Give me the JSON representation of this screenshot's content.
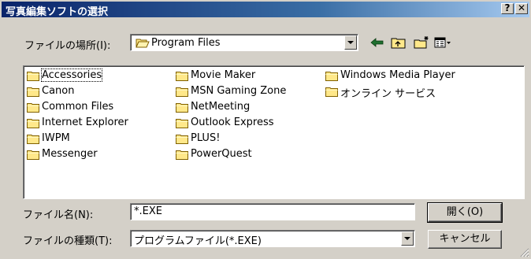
{
  "window": {
    "title": "写真編集ソフトの選択",
    "help_glyph": "?",
    "close_glyph": "✕"
  },
  "lookin": {
    "label": "ファイルの場所",
    "accel": "(I):",
    "value": "Program Files"
  },
  "toolbar": {
    "icons": [
      "back-arrow-icon",
      "up-folder-icon",
      "new-folder-icon",
      "view-menu-icon"
    ]
  },
  "files": {
    "col1": [
      "Accessories",
      "Canon",
      "Common Files",
      "Internet Explorer",
      "IWPM",
      "Messenger"
    ],
    "col2": [
      "Movie Maker",
      "MSN Gaming Zone",
      "NetMeeting",
      "Outlook Express",
      "PLUS!",
      "PowerQuest"
    ],
    "col3": [
      "Windows Media Player",
      "オンライン サービス"
    ]
  },
  "filename": {
    "label": "ファイル名",
    "accel": "(N):",
    "value": "*.EXE"
  },
  "filetype": {
    "label": "ファイルの種類",
    "accel": "(T):",
    "value": "プログラムファイル(*.EXE)"
  },
  "buttons": {
    "open": "開く",
    "open_accel": "(O)",
    "cancel": "キャンセル"
  },
  "colors": {
    "dialog_bg": "#d4d0c8",
    "title_start": "#0a246a",
    "title_end": "#a6caf0",
    "folder_fill": "#ffe88a"
  }
}
